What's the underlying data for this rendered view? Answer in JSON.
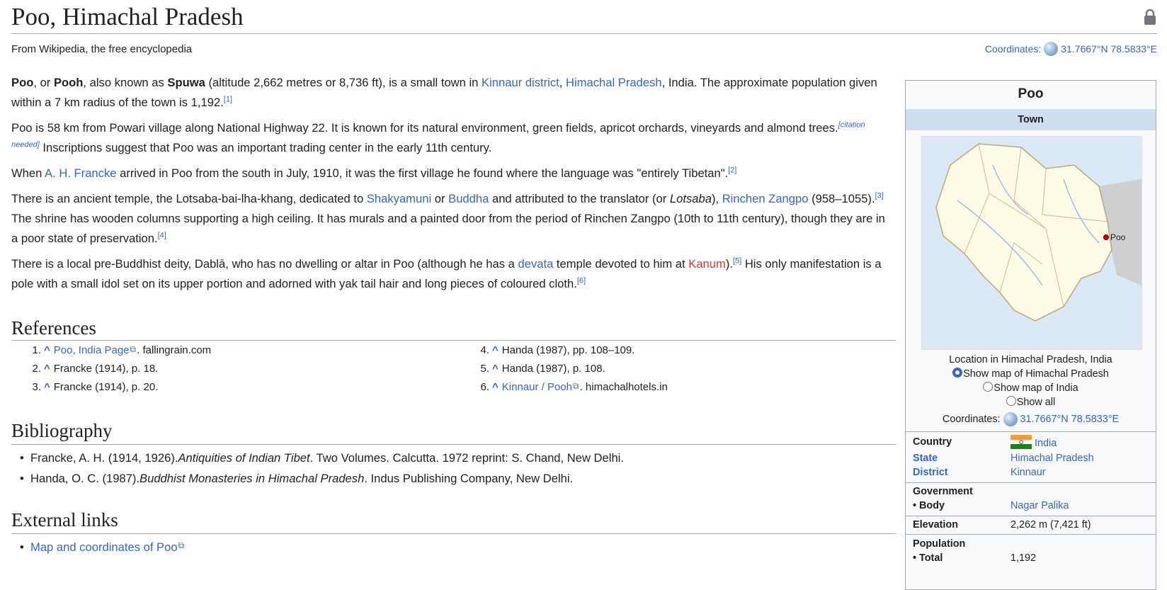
{
  "page": {
    "title": "Poo, Himachal Pradesh",
    "tagline": "From Wikipedia, the free encyclopedia",
    "coordinates_label": "Coordinates:",
    "coordinates_value": "31.7667°N 78.5833°E"
  },
  "article": {
    "p1": {
      "b1": "Poo",
      "t1": ", or ",
      "b2": "Pooh",
      "t2": ", also known as ",
      "b3": "Spuwa",
      "t3": " (altitude 2,662 metres or 8,736 ft), is a small town in ",
      "l1": "Kinnaur district",
      "t4": ", ",
      "l2": "Himachal Pradesh",
      "t5": ", India. The approximate population given within a 7 km radius of the town is 1,192.",
      "ref": "[1]"
    },
    "p2": {
      "t1": "Poo is 58 km from Powari village along National Highway 22. It is known for its natural environment, green fields, apricot orchards, vineyards and almond trees.",
      "cn": "[citation needed]",
      "t2": " Inscriptions suggest that Poo was an important trading center in the early 11th century."
    },
    "p3": {
      "t1": "When ",
      "l1": "A. H. Francke",
      "t2": " arrived in Poo from the south in July, 1910, it was the first village he found where the language was \"entirely Tibetan\".",
      "ref": "[2]"
    },
    "p4": {
      "t1": "There is an ancient temple, the Lotsaba-bai-lha-khang, dedicated to ",
      "l1": "Shakyamuni",
      "t2": " or ",
      "l2": "Buddha",
      "t3": " and attributed to the translator (or ",
      "i1": "Lotsaba",
      "t4": "), ",
      "l3": "Rinchen Zangpo",
      "t5": " (958–1055).",
      "ref1": "[3]",
      "t6": " The shrine has wooden columns supporting a high ceiling. It has murals and a painted door from the period of Rinchen Zangpo (10th to 11th century), though they are in a poor state of preservation.",
      "ref2": "[4]"
    },
    "p5": {
      "t1": "There is a local pre-Buddhist deity, Dablā, who has no dwelling or altar in Poo (although he has a ",
      "l1": "devata",
      "t2": " temple devoted to him at ",
      "l2": "Kanum",
      "t3": ").",
      "ref1": "[5]",
      "t4": " His only manifestation is a pole with a small idol set on its upper portion and adorned with yak tail hair and long pieces of coloured cloth.",
      "ref2": "[6]"
    }
  },
  "references": {
    "heading": "References",
    "caret": "^",
    "items": [
      {
        "num": "1.",
        "link": "Poo, India Page",
        "rest": ". fallingrain.com"
      },
      {
        "num": "2.",
        "link": "",
        "rest": "Francke (1914), p. 18."
      },
      {
        "num": "3.",
        "link": "",
        "rest": "Francke (1914), p. 20."
      },
      {
        "num": "4.",
        "link": "",
        "rest": "Handa (1987), pp. 108–109."
      },
      {
        "num": "5.",
        "link": "",
        "rest": "Handa (1987), p. 108."
      },
      {
        "num": "6.",
        "link": "Kinnaur / Pooh",
        "rest": ". himachalhotels.in"
      }
    ]
  },
  "bibliography": {
    "heading": "Bibliography",
    "items": [
      {
        "pre": "Francke, A. H. (1914, 1926). ",
        "italic": "Antiquities of Indian Tibet",
        "post": ". Two Volumes. Calcutta. 1972 reprint: S. Chand, New Delhi."
      },
      {
        "pre": "Handa, O. C. (1987). ",
        "italic": "Buddhist Monasteries in Himachal Pradesh",
        "post": ". Indus Publishing Company, New Delhi."
      }
    ]
  },
  "external_links": {
    "heading": "External links",
    "items": [
      {
        "link": "Map and coordinates of Poo"
      }
    ]
  },
  "infobox": {
    "title": "Poo",
    "type": "Town",
    "map_marker": "Poo",
    "map_caption": "Location in Himachal Pradesh, India",
    "radio_options": [
      "Show map of Himachal Pradesh",
      "Show map of India",
      "Show all"
    ],
    "selected_option": "Show map of Himachal Pradesh",
    "coordinates_label": "Coordinates:",
    "coordinates_value": "31.7667°N 78.5833°E",
    "rows": {
      "country_label": "Country",
      "country_value": "India",
      "state_label": "State",
      "state_value": "Himachal Pradesh",
      "district_label": "District",
      "district_value": "Kinnaur",
      "government_label": "Government",
      "body_label": "• Body",
      "body_value": "Nagar Palika",
      "elevation_label": "Elevation",
      "elevation_value": "2,262 m (7,421 ft)",
      "population_label": "Population",
      "total_label": "• Total",
      "total_value": "1,192"
    }
  }
}
